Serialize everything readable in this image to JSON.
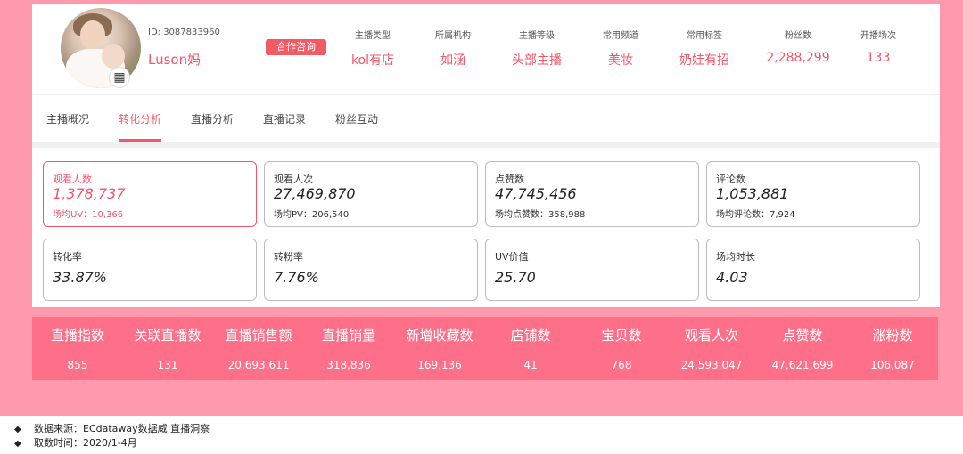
{
  "profile": {
    "id_label": "ID: 3087833960",
    "name": "Luson妈",
    "consult_button": "合作咨询"
  },
  "attributes": [
    {
      "label": "主播类型",
      "value": "kol有店"
    },
    {
      "label": "所属机构",
      "value": "如涵"
    },
    {
      "label": "主播等级",
      "value": "头部主播"
    },
    {
      "label": "常用频道",
      "value": "美妆"
    },
    {
      "label": "常用标签",
      "value": "奶娃有招"
    },
    {
      "label": "粉丝数",
      "value": "2,288,299"
    },
    {
      "label": "开播场次",
      "value": "133"
    }
  ],
  "tabs": [
    {
      "label": "主播概况"
    },
    {
      "label": "转化分析"
    },
    {
      "label": "直播分析"
    },
    {
      "label": "直播记录"
    },
    {
      "label": "粉丝互动"
    }
  ],
  "active_tab_index": 1,
  "metrics_row1": [
    {
      "label": "观看人数",
      "value": "1,378,737",
      "sub": "场均UV：10,366"
    },
    {
      "label": "观看人次",
      "value": "27,469,870",
      "sub": "场均PV：206,540"
    },
    {
      "label": "点赞数",
      "value": "47,745,456",
      "sub": "场均点赞数：358,988"
    },
    {
      "label": "评论数",
      "value": "1,053,881",
      "sub": "场均评论数：7,924"
    }
  ],
  "metrics_row2": [
    {
      "label": "转化率",
      "value": "33.87%"
    },
    {
      "label": "转粉率",
      "value": "7.76%"
    },
    {
      "label": "UV价值",
      "value": "25.70"
    },
    {
      "label": "场均时长",
      "value": "4.03"
    }
  ],
  "stats": [
    {
      "label": "直播指数",
      "value": "855"
    },
    {
      "label": "关联直播数",
      "value": "131"
    },
    {
      "label": "直播销售额",
      "value": "20,693,611"
    },
    {
      "label": "直播销量",
      "value": "318,836"
    },
    {
      "label": "新增收藏数",
      "value": "169,136"
    },
    {
      "label": "店铺数",
      "value": "41"
    },
    {
      "label": "宝贝数",
      "value": "768"
    },
    {
      "label": "观看人次",
      "value": "24,593,047"
    },
    {
      "label": "点赞数",
      "value": "47,621,699"
    },
    {
      "label": "涨粉数",
      "value": "106,087"
    }
  ],
  "notes": {
    "bullet": "◆",
    "source": "数据来源：ECdataway数据威 直播洞察",
    "period": "取数时间：2020/1-4月"
  },
  "colors": {
    "background_pink": "#fe9aac",
    "band_pink": "#fe6f89",
    "accent_red": "#f2566a"
  },
  "icons": {
    "qr": "qr-code-icon",
    "bullet": "diamond-bullet-icon"
  }
}
